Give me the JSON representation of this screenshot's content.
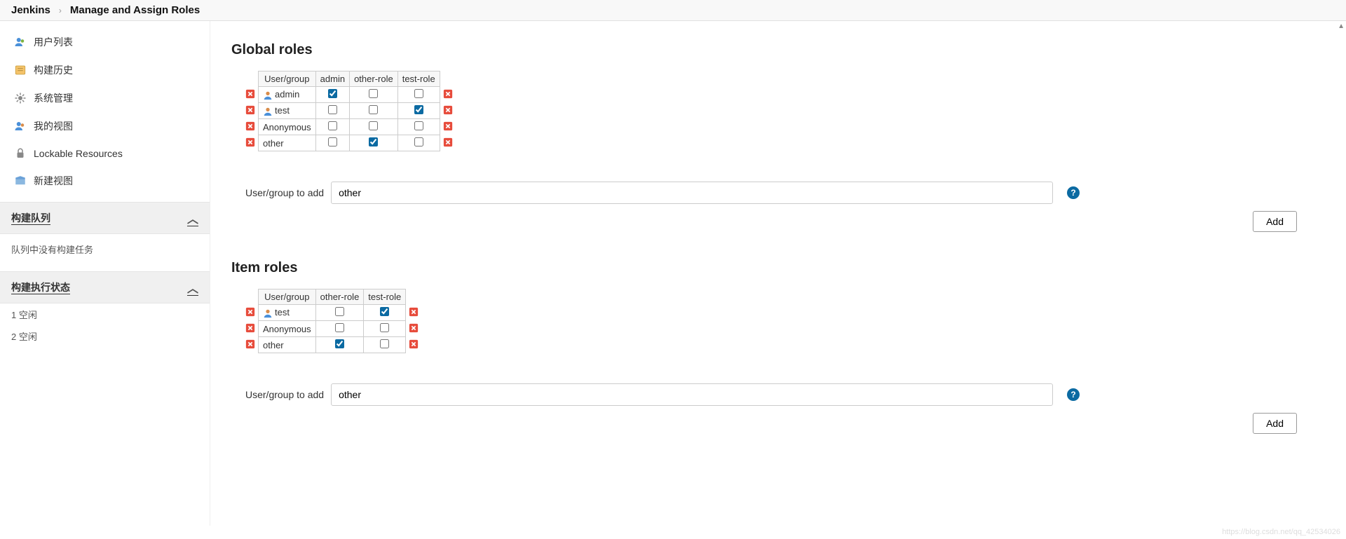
{
  "breadcrumb": {
    "root": "Jenkins",
    "current": "Manage and Assign Roles"
  },
  "sidebar": {
    "items": [
      {
        "label": "用户列表",
        "icon": "users-icon"
      },
      {
        "label": "构建历史",
        "icon": "history-icon"
      },
      {
        "label": "系统管理",
        "icon": "gear-icon"
      },
      {
        "label": "我的视图",
        "icon": "views-icon"
      },
      {
        "label": "Lockable Resources",
        "icon": "lock-icon"
      },
      {
        "label": "新建视图",
        "icon": "new-view-icon"
      }
    ],
    "queue": {
      "title": "构建队列",
      "empty_text": "队列中没有构建任务"
    },
    "executors": {
      "title": "构建执行状态",
      "rows": [
        "1  空闲",
        "2  空闲"
      ]
    }
  },
  "global_roles": {
    "title": "Global roles",
    "columns": [
      "User/group",
      "admin",
      "other-role",
      "test-role"
    ],
    "rows": [
      {
        "name": "admin",
        "user_icon": true,
        "checks": [
          true,
          false,
          false
        ]
      },
      {
        "name": "test",
        "user_icon": true,
        "checks": [
          false,
          false,
          true
        ]
      },
      {
        "name": "Anonymous",
        "user_icon": false,
        "checks": [
          false,
          false,
          false
        ]
      },
      {
        "name": "other",
        "user_icon": false,
        "checks": [
          false,
          true,
          false
        ]
      }
    ],
    "add_label": "User/group to add",
    "add_value": "other",
    "add_button": "Add"
  },
  "item_roles": {
    "title": "Item roles",
    "columns": [
      "User/group",
      "other-role",
      "test-role"
    ],
    "rows": [
      {
        "name": "test",
        "user_icon": true,
        "checks": [
          false,
          true
        ]
      },
      {
        "name": "Anonymous",
        "user_icon": false,
        "checks": [
          false,
          false
        ]
      },
      {
        "name": "other",
        "user_icon": false,
        "checks": [
          true,
          false
        ]
      }
    ],
    "add_label": "User/group to add",
    "add_value": "other",
    "add_button": "Add"
  },
  "watermark": "https://blog.csdn.net/qq_42534026"
}
